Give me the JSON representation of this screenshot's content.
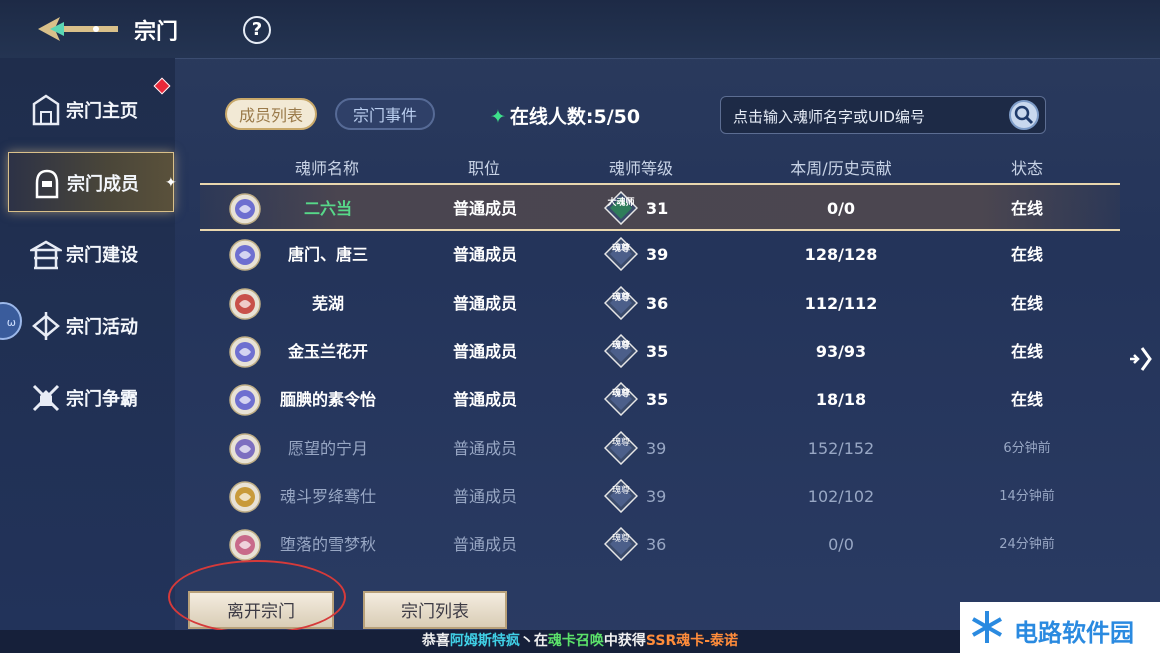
{
  "header": {
    "title": "宗门",
    "help_label": "?"
  },
  "sidebar": {
    "items": [
      {
        "label": "宗门主页",
        "icon": "sect-home-icon"
      },
      {
        "label": "宗门成员",
        "icon": "sect-members-icon",
        "active": true
      },
      {
        "label": "宗门建设",
        "icon": "sect-build-icon"
      },
      {
        "label": "宗门活动",
        "icon": "sect-activity-icon"
      },
      {
        "label": "宗门争霸",
        "icon": "sect-battle-icon"
      }
    ]
  },
  "tabs": {
    "members": "成员列表",
    "events": "宗门事件"
  },
  "online_count": "在线人数:5/50",
  "search": {
    "placeholder": "点击输入魂师名字或UID编号"
  },
  "table": {
    "headers": [
      "魂师名称",
      "职位",
      "魂师等级",
      "本周/历史贡献",
      "状态"
    ],
    "rows": [
      {
        "name": "二六当",
        "position": "普通成员",
        "badge": "大魂师",
        "level": "31",
        "contribution": "0/0",
        "status": "在线",
        "online": true,
        "self": true
      },
      {
        "name": "唐门、唐三",
        "position": "普通成员",
        "badge": "魂尊",
        "level": "39",
        "contribution": "128/128",
        "status": "在线",
        "online": true
      },
      {
        "name": "芜湖",
        "position": "普通成员",
        "badge": "魂尊",
        "level": "36",
        "contribution": "112/112",
        "status": "在线",
        "online": true
      },
      {
        "name": "金玉兰花开",
        "position": "普通成员",
        "badge": "魂尊",
        "level": "35",
        "contribution": "93/93",
        "status": "在线",
        "online": true
      },
      {
        "name": "腼腆的素令怡",
        "position": "普通成员",
        "badge": "魂尊",
        "level": "35",
        "contribution": "18/18",
        "status": "在线",
        "online": true
      },
      {
        "name": "愿望的宁月",
        "position": "普通成员",
        "badge": "魂尊",
        "level": "39",
        "contribution": "152/152",
        "status": "6分钟前",
        "online": false
      },
      {
        "name": "魂斗罗绛骞仕",
        "position": "普通成员",
        "badge": "魂尊",
        "level": "39",
        "contribution": "102/102",
        "status": "14分钟前",
        "online": false
      },
      {
        "name": "堕落的雪梦秋",
        "position": "普通成员",
        "badge": "魂尊",
        "level": "36",
        "contribution": "0/0",
        "status": "24分钟前",
        "online": false
      }
    ]
  },
  "buttons": {
    "leave": "离开宗门",
    "list": "宗门列表"
  },
  "ticker": {
    "p1": "恭喜",
    "p2": "阿姆斯特疯",
    "p3": "丶在",
    "p4": "魂卡召唤",
    "p5": "中获得",
    "p6": "SSR魂卡-泰诺"
  },
  "watermark": {
    "text": "电路软件园"
  },
  "colors": {
    "accent_gold": "#d9c08a",
    "online_green": "#3ee08b",
    "name_green": "#57d889",
    "alert_red": "#e8283a"
  }
}
